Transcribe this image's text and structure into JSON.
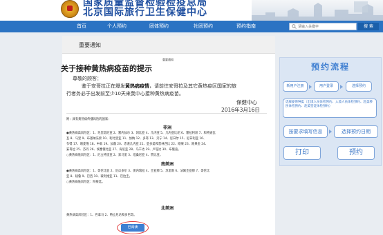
{
  "header": {
    "title_line1": "国家质量监督检验检疫总局",
    "title_line2": "北京国际旅行卫生保健中心"
  },
  "nav": {
    "items": [
      "首页",
      "个人预约",
      "团体预约",
      "社团预约",
      "预约指南"
    ],
    "search_placeholder": "请输入关键字",
    "search_button": "搜 索"
  },
  "notice": {
    "section_title": "重要通知",
    "label": "重要通知",
    "headline": "关于接种黄热病疫苗的提示",
    "greeting": "尊敬的顾客：",
    "body_line1_pre": "鉴于安哥拉正在爆发",
    "body_line1_bold": "黄热病疫情",
    "body_line1_post": "，请前往安哥拉及其它黄热疫区国家的旅",
    "body_line2": "行者务必于出发前至少10天来我中心接种黄热病疫苗。",
    "signature": "保健中心",
    "date": "2016年3月16日",
    "attachment": "附：具有黄热病传播风险的国家：",
    "regions": [
      {
        "name": "非洲",
        "lines": [
          "●黄热病高风险区：1、毛里塔尼亚 2、塞内加尔 3、冈比亚 4、几内亚 5、几内亚比绍 6、塞拉利昂 7、科特迪瓦",
          "瓦 8、马里 9、布基纳法索 10、利比里亚 11、加纳 12、多哥 13、贝宁 14、尼日尔 15、尼日利亚 16、",
          "乍得 17、喀麦隆 18、中非 19、加蓬 20、赤道几内亚 21、圣多美和普林西比 22、刚果 23、刚果金 24、",
          "安哥拉 25、苏丹 26、埃塞俄比亚 27、肯尼亚 28、乌干达 29、卢旺达 30、布隆迪。",
          "○黄热病低风险区：1、厄立特里亚 2、索马里 3、坦桑尼亚 4、赞比亚。"
        ]
      },
      {
        "name": "南美洲",
        "lines": [
          "●黄热病高风险区：1、哥伦比亚 2、厄瓜多尔 3、委内瑞拉 4、圭亚那 5、苏里南 6、法属圭亚那 7、哥伦比",
          "亚 8、秘鲁 9、巴西 10、玻利维亚 11、巴拉圭。",
          "○黄热病低风险区：阿根廷。"
        ]
      },
      {
        "name": "北美洲",
        "lines": [
          "黄热病高风险区：1、巴拿马 2、特立尼达和多巴哥。"
        ]
      }
    ],
    "read_button": "已阅读"
  },
  "flow": {
    "title": "预约流程",
    "row1": [
      "新用户注册",
      "用户登录",
      "选择预约"
    ],
    "row2": "选择安哥种类（出境人员体检预约、入境人员体检预约、赴美移民体检预约、赴美签证体检预约）",
    "row3": [
      "按要求填写信息",
      "选择预约日期"
    ],
    "row4": [
      "打印",
      "预约"
    ]
  }
}
